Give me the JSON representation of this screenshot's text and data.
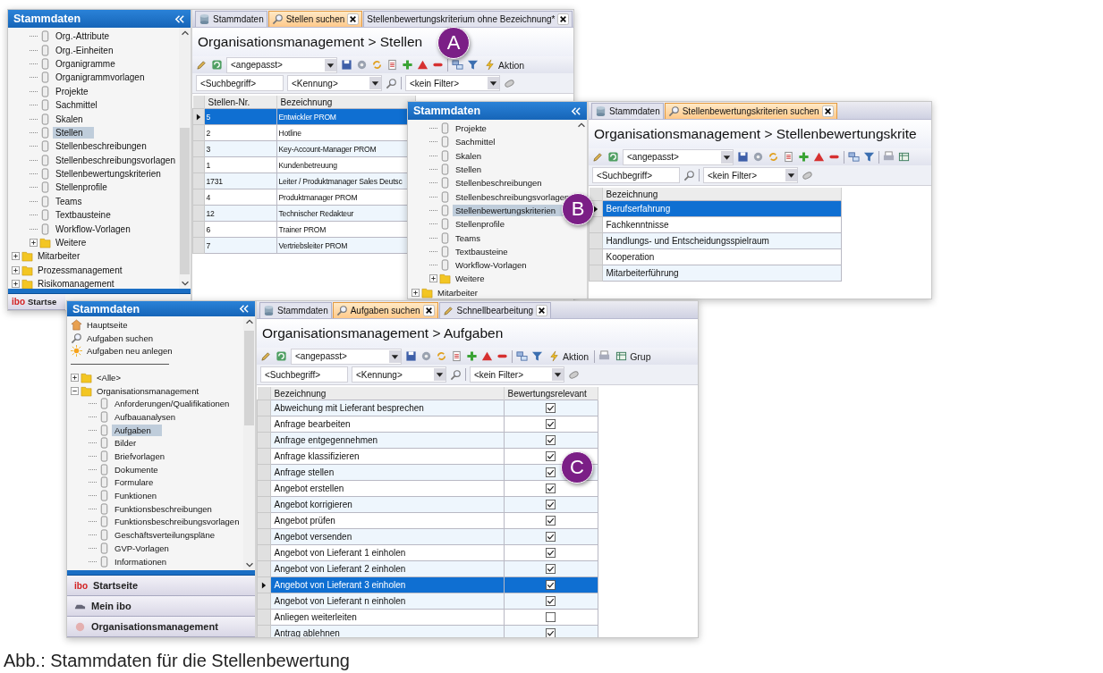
{
  "screenshots": [
    {
      "marker": "A",
      "sidebar": {
        "title": "Stammdaten",
        "tree": [
          {
            "children": [
              {
                "label": "Org.-Attribute",
                "kind": "doc",
                "selected": false
              },
              {
                "label": "Org.-Einheiten",
                "kind": "doc",
                "selected": false
              },
              {
                "label": "Organigramme",
                "kind": "doc",
                "selected": false
              },
              {
                "label": "Organigrammvorlagen",
                "kind": "doc",
                "selected": false
              },
              {
                "label": "Projekte",
                "kind": "doc",
                "selected": false
              },
              {
                "label": "Sachmittel",
                "kind": "doc",
                "selected": false
              },
              {
                "label": "Skalen",
                "kind": "doc",
                "selected": false
              },
              {
                "label": "Stellen",
                "kind": "doc",
                "selected": true
              },
              {
                "label": "Stellenbeschreibungen",
                "kind": "doc",
                "selected": false
              },
              {
                "label": "Stellenbeschreibungsvorlagen",
                "kind": "doc",
                "selected": false
              },
              {
                "label": "Stellenbewertungskriterien",
                "kind": "doc",
                "selected": false
              },
              {
                "label": "Stellenprofile",
                "kind": "doc",
                "selected": false
              },
              {
                "label": "Teams",
                "kind": "doc",
                "selected": false
              },
              {
                "label": "Textbausteine",
                "kind": "doc",
                "selected": false
              },
              {
                "label": "Workflow-Vorlagen",
                "kind": "doc",
                "selected": false
              },
              {
                "label": "Weitere",
                "kind": "folder",
                "expanded": false,
                "selected": false
              }
            ]
          },
          {
            "label": "Mitarbeiter",
            "kind": "folder",
            "expanded": false,
            "selected": false
          },
          {
            "label": "Prozessmanagement",
            "kind": "folder",
            "expanded": false,
            "selected": false
          },
          {
            "label": "Risikomanagement",
            "kind": "folder",
            "expanded": false,
            "selected": false
          }
        ],
        "footer": [
          {
            "logo": "ibo",
            "label": "Startse"
          }
        ]
      },
      "tabs": [
        {
          "label": "Stammdaten",
          "selected": false,
          "closable": false
        },
        {
          "label": "Stellen suchen",
          "selected": true,
          "closable": true
        },
        {
          "label": "Stellenbewertungskriterium ohne Bezeichnung*",
          "selected": false,
          "closable": true
        }
      ],
      "heading": "Organisationsmanagement > Stellen",
      "toolbar": {
        "view": "<angepasst>",
        "action": "Aktion"
      },
      "filters": {
        "search": "<Suchbegriff>",
        "code": "<Kennung>",
        "filter": "<kein Filter>"
      },
      "table": {
        "columns": [
          {
            "label": "Stellen-Nr.",
            "kind": "text"
          },
          {
            "label": "Bezeichnung",
            "kind": "text"
          }
        ],
        "rows": [
          {
            "cells": [
              "5",
              "Entwickler PROM"
            ],
            "selected": true
          },
          {
            "cells": [
              "2",
              "Hotline"
            ],
            "selected": false
          },
          {
            "cells": [
              "3",
              "Key-Account-Manager PROM"
            ],
            "selected": false
          },
          {
            "cells": [
              "1",
              "Kundenbetreuung"
            ],
            "selected": false
          },
          {
            "cells": [
              "1731",
              "Leiter / Produktmanager Sales Deutsc"
            ],
            "selected": false
          },
          {
            "cells": [
              "4",
              "Produktmanager PROM"
            ],
            "selected": false
          },
          {
            "cells": [
              "12",
              "Technischer Redakteur"
            ],
            "selected": false
          },
          {
            "cells": [
              "6",
              "Trainer PROM"
            ],
            "selected": false
          },
          {
            "cells": [
              "7",
              "Vertriebsleiter PROM"
            ],
            "selected": false
          }
        ]
      }
    },
    {
      "marker": "B",
      "sidebar": {
        "title": "Stammdaten",
        "tree": [
          {
            "children": [
              {
                "label": "Projekte",
                "kind": "doc",
                "selected": false
              },
              {
                "label": "Sachmittel",
                "kind": "doc",
                "selected": false
              },
              {
                "label": "Skalen",
                "kind": "doc",
                "selected": false
              },
              {
                "label": "Stellen",
                "kind": "doc",
                "selected": false
              },
              {
                "label": "Stellenbeschreibungen",
                "kind": "doc",
                "selected": false
              },
              {
                "label": "Stellenbeschreibungsvorlagen",
                "kind": "doc",
                "selected": false
              },
              {
                "label": "Stellenbewertungskriterien",
                "kind": "doc",
                "selected": true
              },
              {
                "label": "Stellenprofile",
                "kind": "doc",
                "selected": false
              },
              {
                "label": "Teams",
                "kind": "doc",
                "selected": false
              },
              {
                "label": "Textbausteine",
                "kind": "doc",
                "selected": false
              },
              {
                "label": "Workflow-Vorlagen",
                "kind": "doc",
                "selected": false
              },
              {
                "label": "Weitere",
                "kind": "folder",
                "expanded": false,
                "selected": false
              }
            ]
          },
          {
            "label": "Mitarbeiter",
            "kind": "folder",
            "expanded": false,
            "selected": false
          }
        ]
      },
      "tabs": [
        {
          "label": "Stammdaten",
          "selected": false,
          "closable": false
        },
        {
          "label": "Stellenbewertungskriterien suchen",
          "selected": true,
          "closable": true
        }
      ],
      "heading": "Organisationsmanagement > Stellenbewertungskrite",
      "toolbar": {
        "view": "<angepasst>"
      },
      "filters": {
        "search": "<Suchbegriff>",
        "filter": "<kein Filter>"
      },
      "table": {
        "columns": [
          {
            "label": "Bezeichnung",
            "kind": "text"
          }
        ],
        "rows": [
          {
            "cells": [
              "Berufserfahrung"
            ],
            "selected": true
          },
          {
            "cells": [
              "Fachkenntnisse"
            ],
            "selected": false
          },
          {
            "cells": [
              "Handlungs- und Entscheidungsspielraum"
            ],
            "selected": false
          },
          {
            "cells": [
              "Kooperation"
            ],
            "selected": false
          },
          {
            "cells": [
              "Mitarbeiterführung"
            ],
            "selected": false
          }
        ]
      }
    },
    {
      "marker": "C",
      "sidebar": {
        "title": "Stammdaten",
        "links": [
          {
            "label": "Hauptseite"
          },
          {
            "label": "Aufgaben suchen"
          },
          {
            "label": "Aufgaben neu anlegen"
          }
        ],
        "tree": [
          {
            "label": "<Alle>",
            "kind": "folder",
            "expanded": false,
            "selected": false
          },
          {
            "label": "Organisationsmanagement",
            "kind": "folder",
            "expanded": true,
            "selected": false,
            "children": [
              {
                "label": "Anforderungen/Qualifikationen",
                "kind": "doc",
                "selected": false
              },
              {
                "label": "Aufbauanalysen",
                "kind": "doc",
                "selected": false
              },
              {
                "label": "Aufgaben",
                "kind": "doc",
                "selected": true
              },
              {
                "label": "Bilder",
                "kind": "doc",
                "selected": false
              },
              {
                "label": "Briefvorlagen",
                "kind": "doc",
                "selected": false
              },
              {
                "label": "Dokumente",
                "kind": "doc",
                "selected": false
              },
              {
                "label": "Formulare",
                "kind": "doc",
                "selected": false
              },
              {
                "label": "Funktionen",
                "kind": "doc",
                "selected": false
              },
              {
                "label": "Funktionsbeschreibungen",
                "kind": "doc",
                "selected": false
              },
              {
                "label": "Funktionsbeschreibungsvorlagen",
                "kind": "doc",
                "selected": false
              },
              {
                "label": "Geschäftsverteilungspläne",
                "kind": "doc",
                "selected": false
              },
              {
                "label": "GVP-Vorlagen",
                "kind": "doc",
                "selected": false
              },
              {
                "label": "Informationen",
                "kind": "doc",
                "selected": false
              }
            ]
          }
        ],
        "footer": [
          {
            "logo": "ibo",
            "label": "Startseite"
          },
          {
            "label": "Mein ibo"
          },
          {
            "label": "Organisationsmanagement"
          }
        ]
      },
      "tabs": [
        {
          "label": "Stammdaten",
          "selected": false,
          "closable": false
        },
        {
          "label": "Aufgaben suchen",
          "selected": true,
          "closable": true
        },
        {
          "label": "Schnellbearbeitung",
          "selected": false,
          "closable": true
        }
      ],
      "heading": "Organisationsmanagement > Aufgaben",
      "toolbar": {
        "view": "<angepasst>",
        "action": "Aktion",
        "group": "Grup"
      },
      "filters": {
        "search": "<Suchbegriff>",
        "code": "<Kennung>",
        "filter": "<kein Filter>"
      },
      "table": {
        "columns": [
          {
            "label": "Bezeichnung",
            "kind": "text"
          },
          {
            "label": "Bewertungsrelevant",
            "kind": "check"
          }
        ],
        "rows": [
          {
            "cells": [
              "Abweichung mit Lieferant besprechen"
            ],
            "checked": true,
            "selected": false
          },
          {
            "cells": [
              "Anfrage bearbeiten"
            ],
            "checked": true,
            "selected": false
          },
          {
            "cells": [
              "Anfrage entgegennehmen"
            ],
            "checked": true,
            "selected": false
          },
          {
            "cells": [
              "Anfrage klassifizieren"
            ],
            "checked": true,
            "selected": false
          },
          {
            "cells": [
              "Anfrage stellen"
            ],
            "checked": true,
            "selected": false
          },
          {
            "cells": [
              "Angebot erstellen"
            ],
            "checked": true,
            "selected": false
          },
          {
            "cells": [
              "Angebot korrigieren"
            ],
            "checked": true,
            "selected": false
          },
          {
            "cells": [
              "Angebot prüfen"
            ],
            "checked": true,
            "selected": false
          },
          {
            "cells": [
              "Angebot versenden"
            ],
            "checked": true,
            "selected": false
          },
          {
            "cells": [
              "Angebot von Lieferant 1 einholen"
            ],
            "checked": true,
            "selected": false
          },
          {
            "cells": [
              "Angebot von Lieferant 2 einholen"
            ],
            "checked": true,
            "selected": false
          },
          {
            "cells": [
              "Angebot von Lieferant 3 einholen"
            ],
            "checked": true,
            "selected": true
          },
          {
            "cells": [
              "Angebot von Lieferant n einholen"
            ],
            "checked": true,
            "selected": false
          },
          {
            "cells": [
              "Anliegen weiterleiten"
            ],
            "checked": false,
            "selected": false
          },
          {
            "cells": [
              "Antrag ablehnen"
            ],
            "checked": true,
            "selected": false
          }
        ]
      }
    }
  ],
  "caption": "Abb.: Stammdaten für die Stellenbewertung"
}
